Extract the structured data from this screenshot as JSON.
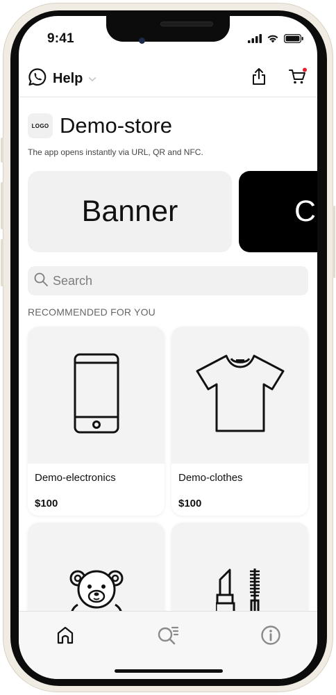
{
  "status_bar": {
    "time": "9:41"
  },
  "header": {
    "help_label": "Help",
    "icons": [
      "whatsapp-icon",
      "chevron-down-icon",
      "share-icon",
      "cart-icon"
    ],
    "cart_badge_color": "#e5202a"
  },
  "store": {
    "logo_text": "LOGO",
    "name": "Demo-store",
    "tagline": "The app opens instantly via URL, QR and NFC."
  },
  "banners": [
    {
      "label": "Banner",
      "background": "#f1f1f1"
    },
    {
      "label": "C",
      "background": "#000000"
    }
  ],
  "search": {
    "placeholder": "Search"
  },
  "recommended": {
    "title": "RECOMMENDED FOR YOU",
    "products": [
      {
        "name": "Demo-electronics",
        "price": "$100",
        "icon": "smartphone-icon"
      },
      {
        "name": "Demo-clothes",
        "price": "$100",
        "icon": "tshirt-icon"
      },
      {
        "name": "",
        "price": "",
        "icon": "teddy-bear-icon"
      },
      {
        "name": "",
        "price": "",
        "icon": "lipstick-mascara-icon"
      }
    ]
  },
  "tab_bar": {
    "items": [
      {
        "icon": "home-icon"
      },
      {
        "icon": "search-list-icon"
      },
      {
        "icon": "info-icon"
      }
    ]
  }
}
